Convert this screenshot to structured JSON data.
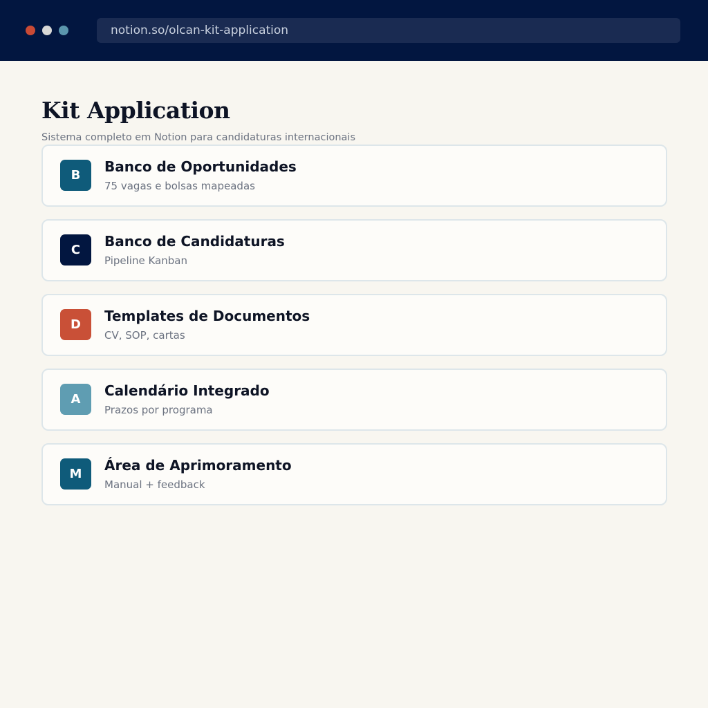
{
  "browser": {
    "url": "notion.so/olcan-kit-application",
    "window_dots": [
      {
        "name": "close",
        "color": "#c94a35"
      },
      {
        "name": "minimize",
        "color": "#d8d8d6"
      },
      {
        "name": "maximize",
        "color": "#5b96ad"
      }
    ]
  },
  "page": {
    "title": "Kit Application",
    "subtitle": "Sistema completo em Notion para candidaturas internacionais"
  },
  "cards": [
    {
      "letter": "B",
      "title": "Banco de Oportunidades",
      "description": "75 vagas e bolsas mapeadas",
      "color": "#0f5b7a"
    },
    {
      "letter": "C",
      "title": "Banco de Candidaturas",
      "description": "Pipeline Kanban",
      "color": "#021640"
    },
    {
      "letter": "D",
      "title": "Templates de Documentos",
      "description": "CV, SOP, cartas",
      "color": "#c95037"
    },
    {
      "letter": "A",
      "title": "Calendário Integrado",
      "description": "Prazos por programa",
      "color": "#5f9db2"
    },
    {
      "letter": "M",
      "title": "Área de Aprimoramento",
      "description": "Manual + feedback",
      "color": "#0f5b7a"
    }
  ]
}
